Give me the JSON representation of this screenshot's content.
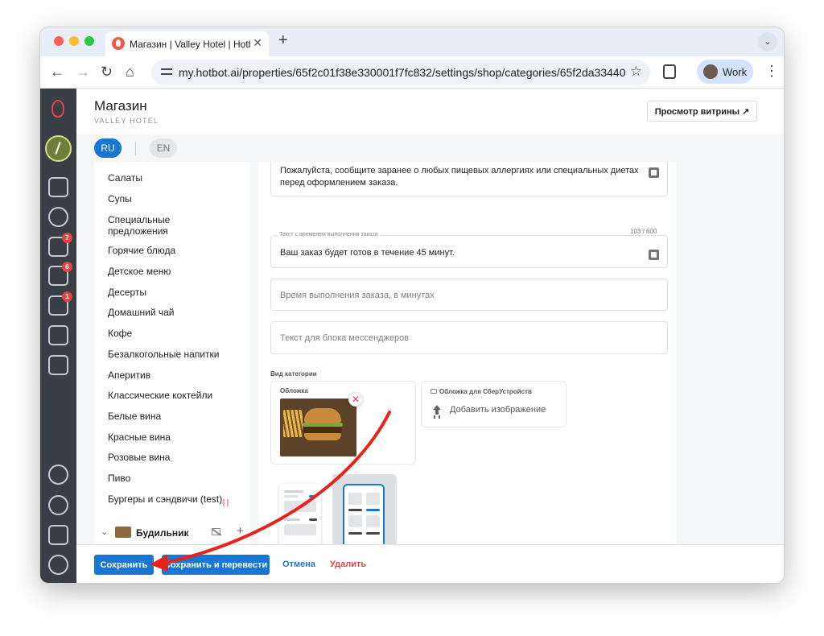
{
  "browser": {
    "tab_title": "Магазин | Valley Hotel | Hotbot",
    "url": "my.hotbot.ai/properties/65f2c01f38e330001f7fc832/settings/shop/categories/65f2da33440...",
    "profile_label": "Work"
  },
  "header": {
    "title": "Магазин",
    "subtitle": "VALLEY HOTEL",
    "preview_button": "Просмотр витрины ↗"
  },
  "languages": [
    "RU",
    "EN"
  ],
  "rail": {
    "badges": {
      "inbox": "7",
      "reviews": "6",
      "cart": "1"
    }
  },
  "categories": [
    "Салаты",
    "Супы",
    "Специальные предложения",
    "Горячие блюда",
    "Детское меню",
    "Десерты",
    "Домашний чай",
    "Кофе",
    "Безалкогольные напитки",
    "Аперитив",
    "Классические коктейли",
    "Белые вина",
    "Красные вина",
    "Розовые вина",
    "Пиво",
    "Бургеры и сэндвичи (test)"
  ],
  "group": {
    "name": "Будильник"
  },
  "form": {
    "allergy_text": "Пожалуйста, сообщите заранее о любых пищевых аллергиях или специальных диетах перед оформлением заказа.",
    "time_text_label": "Текст с временем выполнения заказа",
    "counter": "103 / 600",
    "time_text_value": "Ваш заказ будет готов в течение 45 минут.",
    "time_minutes_placeholder": "Время выполнения заказа, в минутах",
    "messenger_placeholder": "Текст для блока мессенджеров",
    "view_label": "Вид категории",
    "cover_label": "Обложка",
    "sber_cover_label": "Обложка для СберУстройств",
    "add_image": "Добавить изображение"
  },
  "footer": {
    "save": "Сохранить",
    "save_translate": "Сохранить и перевести",
    "cancel": "Отмена",
    "delete": "Удалить"
  },
  "colors": {
    "accent": "#1976d2",
    "danger": "#e04646",
    "rail": "#3a3f45",
    "annotation_arrow": "#e8231a"
  }
}
